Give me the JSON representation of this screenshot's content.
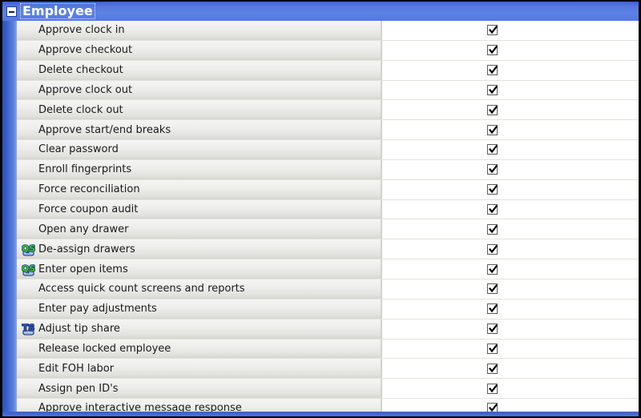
{
  "window": {
    "background_color": "#000000",
    "accent_color": "#5b82e0"
  },
  "section": {
    "title": "Employee",
    "collapse_icon": "minus-icon",
    "expanded": true,
    "header_color": "#5b82e0"
  },
  "columns": {
    "label_header": "",
    "value_header": ""
  },
  "rows": [
    {
      "label": "Approve clock in",
      "icon": "",
      "checked": true
    },
    {
      "label": "Approve checkout",
      "icon": "",
      "checked": true
    },
    {
      "label": "Delete checkout",
      "icon": "",
      "checked": true
    },
    {
      "label": "Approve clock out",
      "icon": "",
      "checked": true
    },
    {
      "label": "Delete clock out",
      "icon": "",
      "checked": true
    },
    {
      "label": "Approve start/end breaks",
      "icon": "",
      "checked": true
    },
    {
      "label": "Clear password",
      "icon": "",
      "checked": true
    },
    {
      "label": "Enroll fingerprints",
      "icon": "",
      "checked": true
    },
    {
      "label": "Force reconciliation",
      "icon": "",
      "checked": true
    },
    {
      "label": "Force coupon audit",
      "icon": "",
      "checked": true
    },
    {
      "label": "Open any drawer",
      "icon": "",
      "checked": true
    },
    {
      "label": "De-assign drawers",
      "icon": "qs",
      "checked": true
    },
    {
      "label": "Enter open items",
      "icon": "qs",
      "checked": true
    },
    {
      "label": "Access quick count screens and reports",
      "icon": "",
      "checked": true
    },
    {
      "label": "Enter pay adjustments",
      "icon": "",
      "checked": true
    },
    {
      "label": "Adjust tip share",
      "icon": "ts",
      "checked": true
    },
    {
      "label": "Release locked employee",
      "icon": "",
      "checked": true
    },
    {
      "label": "Edit FOH labor",
      "icon": "",
      "checked": true
    },
    {
      "label": "Assign pen ID's",
      "icon": "",
      "checked": true
    },
    {
      "label": "Approve interactive message response",
      "icon": "",
      "checked": true
    }
  ],
  "icons": {
    "qs": {
      "name": "quick-service-icon",
      "label": "QS",
      "color": "#33cc33",
      "outline": "#16306e"
    },
    "ts": {
      "name": "table-service-icon",
      "label": "TS",
      "color": "#2b55c4",
      "outline": "#12205c"
    }
  }
}
